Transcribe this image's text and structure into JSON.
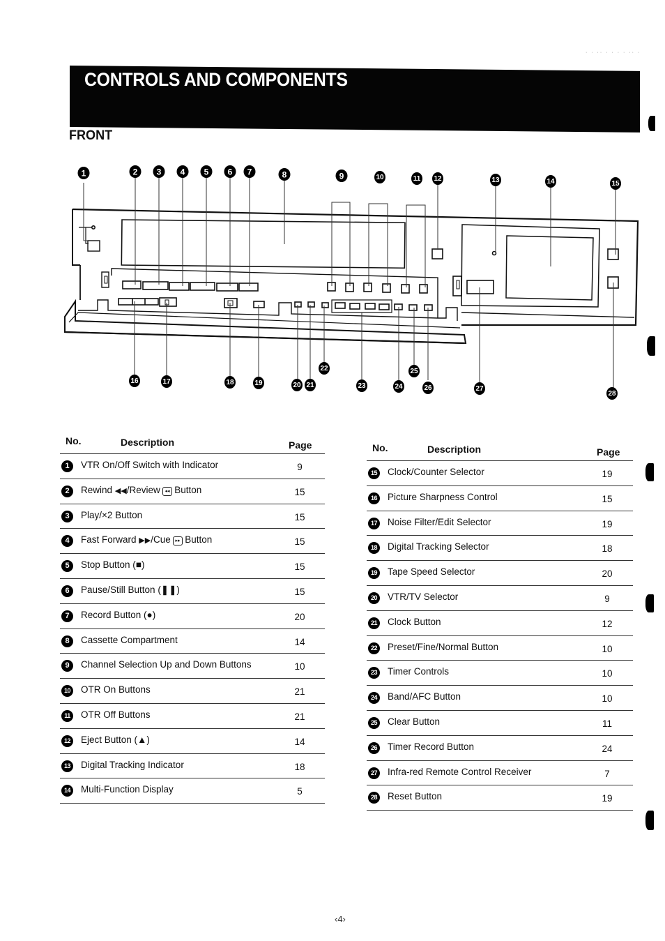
{
  "header": {
    "title": "CONTROLS AND COMPONENTS",
    "section": "FRONT"
  },
  "diagram": {
    "callouts_top": [
      "1",
      "2",
      "3",
      "4",
      "5",
      "6",
      "7",
      "8",
      "9",
      "10",
      "11",
      "12",
      "13",
      "14",
      "15"
    ],
    "callouts_bottom": [
      "16",
      "17",
      "18",
      "19",
      "20",
      "21",
      "22",
      "23",
      "24",
      "25",
      "26",
      "27",
      "28"
    ]
  },
  "table_left": {
    "headers": {
      "no": "No.",
      "description": "Description",
      "page": "Page"
    },
    "rows": [
      {
        "no": "1",
        "description": "VTR On/Off Switch with Indicator",
        "page": "9"
      },
      {
        "no": "2",
        "description": "Rewind",
        "symbol": "◀◀",
        "description_mid": "/Review",
        "box_symbol": "◂◂",
        "description_end": "Button",
        "page": "15"
      },
      {
        "no": "3",
        "description": "Play/×2 Button",
        "page": "15"
      },
      {
        "no": "4",
        "description": "Fast Forward",
        "symbol": "▶▶",
        "description_mid": "/Cue",
        "box_symbol": "▸▸",
        "description_end": "Button",
        "page": "15"
      },
      {
        "no": "5",
        "description": "Stop Button (■)",
        "page": "15"
      },
      {
        "no": "6",
        "description": "Pause/Still Button (❚❚)",
        "page": "15"
      },
      {
        "no": "7",
        "description": "Record Button (●)",
        "page": "20"
      },
      {
        "no": "8",
        "description": "Cassette Compartment",
        "page": "14"
      },
      {
        "no": "9",
        "description": "Channel Selection Up and Down Buttons",
        "page": "10"
      },
      {
        "no": "10",
        "description": "OTR On Buttons",
        "page": "21"
      },
      {
        "no": "11",
        "description": "OTR Off Buttons",
        "page": "21"
      },
      {
        "no": "12",
        "description": "Eject Button (▲)",
        "page": "14"
      },
      {
        "no": "13",
        "description": "Digital Tracking Indicator",
        "page": "18"
      },
      {
        "no": "14",
        "description": "Multi-Function Display",
        "page": "5"
      }
    ]
  },
  "table_right": {
    "headers": {
      "no": "No.",
      "description": "Description",
      "page": "Page"
    },
    "rows": [
      {
        "no": "15",
        "description": "Clock/Counter Selector",
        "page": "19"
      },
      {
        "no": "16",
        "description": "Picture Sharpness Control",
        "page": "15"
      },
      {
        "no": "17",
        "description": "Noise Filter/Edit Selector",
        "page": "19"
      },
      {
        "no": "18",
        "description": "Digital Tracking Selector",
        "page": "18"
      },
      {
        "no": "19",
        "description": "Tape Speed Selector",
        "page": "20"
      },
      {
        "no": "20",
        "description": "VTR/TV Selector",
        "page": "9"
      },
      {
        "no": "21",
        "description": "Clock Button",
        "page": "12"
      },
      {
        "no": "22",
        "description": "Preset/Fine/Normal Button",
        "page": "10"
      },
      {
        "no": "23",
        "description": "Timer Controls",
        "page": "10"
      },
      {
        "no": "24",
        "description": "Band/AFC Button",
        "page": "10"
      },
      {
        "no": "25",
        "description": "Clear Button",
        "page": "11"
      },
      {
        "no": "26",
        "description": "Timer Record Button",
        "page": "24"
      },
      {
        "no": "27",
        "description": "Infra-red Remote Control Receiver",
        "page": "7"
      },
      {
        "no": "28",
        "description": "Reset Button",
        "page": "19"
      }
    ]
  },
  "footer": {
    "page_number": "‹4›"
  }
}
